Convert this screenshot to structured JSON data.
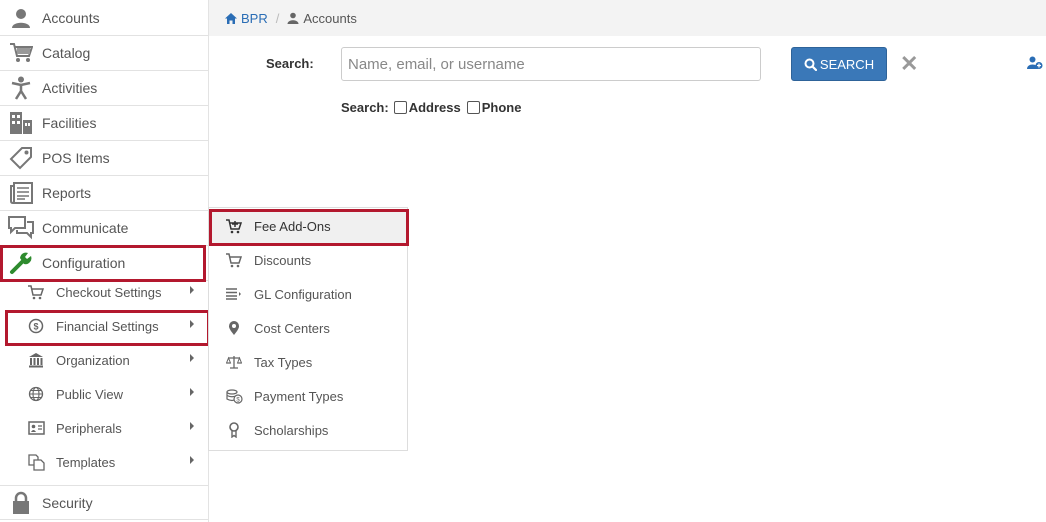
{
  "sidebar": {
    "items": [
      {
        "label": "Accounts",
        "icon": "user-icon"
      },
      {
        "label": "Catalog",
        "icon": "cart-icon"
      },
      {
        "label": "Activities",
        "icon": "person-icon"
      },
      {
        "label": "Facilities",
        "icon": "building-icon"
      },
      {
        "label": "POS Items",
        "icon": "tag-icon"
      },
      {
        "label": "Reports",
        "icon": "reports-icon"
      },
      {
        "label": "Communicate",
        "icon": "chat-icon"
      },
      {
        "label": "Configuration",
        "icon": "wrench-icon"
      }
    ],
    "config_sub": [
      {
        "label": "Checkout Settings",
        "icon": "cart-icon"
      },
      {
        "label": "Financial Settings",
        "icon": "dollar-circle-icon"
      },
      {
        "label": "Organization",
        "icon": "institution-icon"
      },
      {
        "label": "Public View",
        "icon": "globe-icon"
      },
      {
        "label": "Peripherals",
        "icon": "id-card-icon"
      },
      {
        "label": "Templates",
        "icon": "copy-icon"
      }
    ],
    "security": {
      "label": "Security",
      "icon": "lock-icon"
    }
  },
  "breadcrumb": {
    "home": "BPR",
    "separator": "/",
    "current": "Accounts"
  },
  "search": {
    "label": "Search:",
    "placeholder": "Name, email, or username",
    "button": "SEARCH",
    "options_label": "Search:",
    "address_label": "Address",
    "phone_label": "Phone"
  },
  "flyout": {
    "items": [
      {
        "label": "Fee Add-Ons",
        "icon": "cart-plus-icon"
      },
      {
        "label": "Discounts",
        "icon": "cart-icon"
      },
      {
        "label": "GL Configuration",
        "icon": "list-icon"
      },
      {
        "label": "Cost Centers",
        "icon": "map-pin-icon"
      },
      {
        "label": "Tax Types",
        "icon": "scale-icon"
      },
      {
        "label": "Payment Types",
        "icon": "money-icon"
      },
      {
        "label": "Scholarships",
        "icon": "award-icon"
      }
    ]
  },
  "colors": {
    "highlight": "#b3182e",
    "primary": "#3a78b8",
    "wrench": "#2e8b2e"
  }
}
